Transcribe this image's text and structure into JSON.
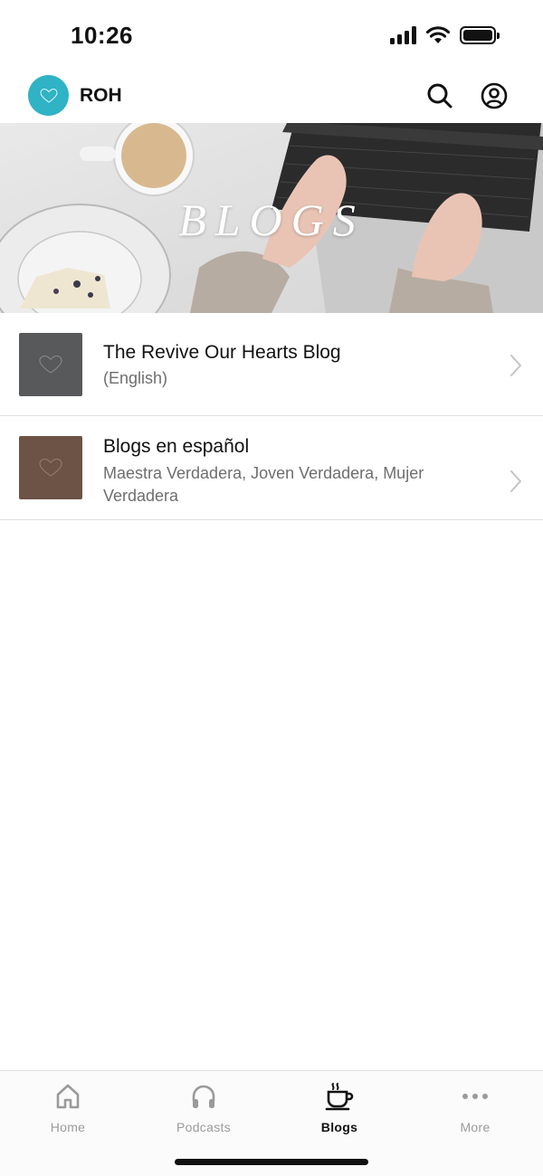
{
  "status_bar": {
    "time": "10:26"
  },
  "app_bar": {
    "title": "ROH",
    "logo_color": "#2fb3c5",
    "search_icon": "search-icon",
    "account_icon": "account-circle-icon"
  },
  "hero": {
    "title": "BLOGS"
  },
  "blogs": [
    {
      "title": "The Revive Our Hearts Blog",
      "subtitle": "(English)",
      "thumb_color": "#58595b"
    },
    {
      "title": "Blogs en español",
      "subtitle": "Maestra Verdadera, Joven Verdadera, Mujer Verdadera",
      "thumb_color": "#6d5246"
    }
  ],
  "tabs": [
    {
      "label": "Home",
      "icon": "home-icon",
      "active": false
    },
    {
      "label": "Podcasts",
      "icon": "headphones-icon",
      "active": false
    },
    {
      "label": "Blogs",
      "icon": "coffee-cup-icon",
      "active": true
    },
    {
      "label": "More",
      "icon": "more-dots-icon",
      "active": false
    }
  ],
  "colors": {
    "active_tab": "#111111",
    "inactive_tab": "#9a9a9a",
    "divider": "#dedede"
  }
}
